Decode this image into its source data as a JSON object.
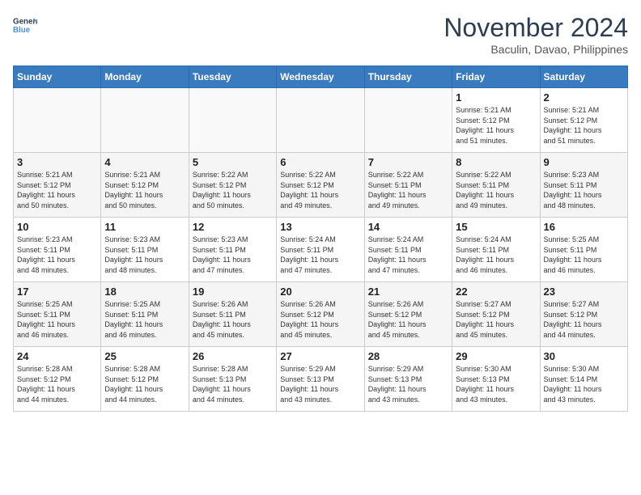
{
  "header": {
    "logo_line1": "General",
    "logo_line2": "Blue",
    "month": "November 2024",
    "location": "Baculin, Davao, Philippines"
  },
  "weekdays": [
    "Sunday",
    "Monday",
    "Tuesday",
    "Wednesday",
    "Thursday",
    "Friday",
    "Saturday"
  ],
  "weeks": [
    [
      {
        "day": "",
        "info": ""
      },
      {
        "day": "",
        "info": ""
      },
      {
        "day": "",
        "info": ""
      },
      {
        "day": "",
        "info": ""
      },
      {
        "day": "",
        "info": ""
      },
      {
        "day": "1",
        "info": "Sunrise: 5:21 AM\nSunset: 5:12 PM\nDaylight: 11 hours\nand 51 minutes."
      },
      {
        "day": "2",
        "info": "Sunrise: 5:21 AM\nSunset: 5:12 PM\nDaylight: 11 hours\nand 51 minutes."
      }
    ],
    [
      {
        "day": "3",
        "info": "Sunrise: 5:21 AM\nSunset: 5:12 PM\nDaylight: 11 hours\nand 50 minutes."
      },
      {
        "day": "4",
        "info": "Sunrise: 5:21 AM\nSunset: 5:12 PM\nDaylight: 11 hours\nand 50 minutes."
      },
      {
        "day": "5",
        "info": "Sunrise: 5:22 AM\nSunset: 5:12 PM\nDaylight: 11 hours\nand 50 minutes."
      },
      {
        "day": "6",
        "info": "Sunrise: 5:22 AM\nSunset: 5:12 PM\nDaylight: 11 hours\nand 49 minutes."
      },
      {
        "day": "7",
        "info": "Sunrise: 5:22 AM\nSunset: 5:11 PM\nDaylight: 11 hours\nand 49 minutes."
      },
      {
        "day": "8",
        "info": "Sunrise: 5:22 AM\nSunset: 5:11 PM\nDaylight: 11 hours\nand 49 minutes."
      },
      {
        "day": "9",
        "info": "Sunrise: 5:23 AM\nSunset: 5:11 PM\nDaylight: 11 hours\nand 48 minutes."
      }
    ],
    [
      {
        "day": "10",
        "info": "Sunrise: 5:23 AM\nSunset: 5:11 PM\nDaylight: 11 hours\nand 48 minutes."
      },
      {
        "day": "11",
        "info": "Sunrise: 5:23 AM\nSunset: 5:11 PM\nDaylight: 11 hours\nand 48 minutes."
      },
      {
        "day": "12",
        "info": "Sunrise: 5:23 AM\nSunset: 5:11 PM\nDaylight: 11 hours\nand 47 minutes."
      },
      {
        "day": "13",
        "info": "Sunrise: 5:24 AM\nSunset: 5:11 PM\nDaylight: 11 hours\nand 47 minutes."
      },
      {
        "day": "14",
        "info": "Sunrise: 5:24 AM\nSunset: 5:11 PM\nDaylight: 11 hours\nand 47 minutes."
      },
      {
        "day": "15",
        "info": "Sunrise: 5:24 AM\nSunset: 5:11 PM\nDaylight: 11 hours\nand 46 minutes."
      },
      {
        "day": "16",
        "info": "Sunrise: 5:25 AM\nSunset: 5:11 PM\nDaylight: 11 hours\nand 46 minutes."
      }
    ],
    [
      {
        "day": "17",
        "info": "Sunrise: 5:25 AM\nSunset: 5:11 PM\nDaylight: 11 hours\nand 46 minutes."
      },
      {
        "day": "18",
        "info": "Sunrise: 5:25 AM\nSunset: 5:11 PM\nDaylight: 11 hours\nand 46 minutes."
      },
      {
        "day": "19",
        "info": "Sunrise: 5:26 AM\nSunset: 5:11 PM\nDaylight: 11 hours\nand 45 minutes."
      },
      {
        "day": "20",
        "info": "Sunrise: 5:26 AM\nSunset: 5:12 PM\nDaylight: 11 hours\nand 45 minutes."
      },
      {
        "day": "21",
        "info": "Sunrise: 5:26 AM\nSunset: 5:12 PM\nDaylight: 11 hours\nand 45 minutes."
      },
      {
        "day": "22",
        "info": "Sunrise: 5:27 AM\nSunset: 5:12 PM\nDaylight: 11 hours\nand 45 minutes."
      },
      {
        "day": "23",
        "info": "Sunrise: 5:27 AM\nSunset: 5:12 PM\nDaylight: 11 hours\nand 44 minutes."
      }
    ],
    [
      {
        "day": "24",
        "info": "Sunrise: 5:28 AM\nSunset: 5:12 PM\nDaylight: 11 hours\nand 44 minutes."
      },
      {
        "day": "25",
        "info": "Sunrise: 5:28 AM\nSunset: 5:12 PM\nDaylight: 11 hours\nand 44 minutes."
      },
      {
        "day": "26",
        "info": "Sunrise: 5:28 AM\nSunset: 5:13 PM\nDaylight: 11 hours\nand 44 minutes."
      },
      {
        "day": "27",
        "info": "Sunrise: 5:29 AM\nSunset: 5:13 PM\nDaylight: 11 hours\nand 43 minutes."
      },
      {
        "day": "28",
        "info": "Sunrise: 5:29 AM\nSunset: 5:13 PM\nDaylight: 11 hours\nand 43 minutes."
      },
      {
        "day": "29",
        "info": "Sunrise: 5:30 AM\nSunset: 5:13 PM\nDaylight: 11 hours\nand 43 minutes."
      },
      {
        "day": "30",
        "info": "Sunrise: 5:30 AM\nSunset: 5:14 PM\nDaylight: 11 hours\nand 43 minutes."
      }
    ]
  ]
}
